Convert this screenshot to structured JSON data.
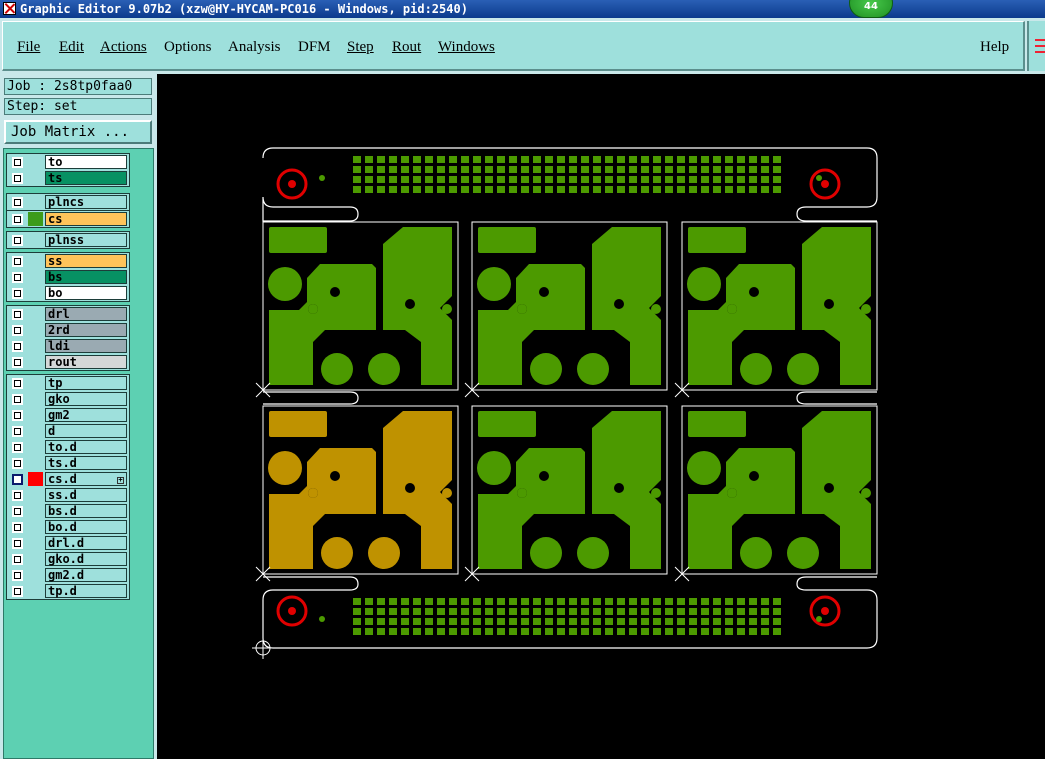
{
  "window": {
    "title": "Graphic Editor 9.07b2 (xzw@HY-HYCAM-PC016 - Windows, pid:2540)",
    "badge_count": "44"
  },
  "menubar": {
    "items": [
      {
        "label": "File",
        "underline": true
      },
      {
        "label": "Edit",
        "underline": true
      },
      {
        "label": "Actions",
        "underline": true
      },
      {
        "label": "Options",
        "underline": false
      },
      {
        "label": "Analysis",
        "underline": false
      },
      {
        "label": "DFM",
        "underline": false
      },
      {
        "label": "Step",
        "underline": true
      },
      {
        "label": "Rout",
        "underline": true
      },
      {
        "label": "Windows",
        "underline": true
      }
    ],
    "help_label": "Help"
  },
  "left_panel": {
    "job": "Job : 2s8tp0faa0",
    "step": "Step: set",
    "job_matrix_button": "Job Matrix ..."
  },
  "layers": [
    {
      "name": "to",
      "bg": "#ffffff",
      "color": "",
      "checked": false
    },
    {
      "name": "ts",
      "bg": "#079163",
      "color": "",
      "checked": false
    },
    {
      "name": "plncs",
      "bg": "#9ee0dc",
      "color": "",
      "checked": false
    },
    {
      "name": "cs",
      "bg": "#ffc45a",
      "color": "#3c9b1a",
      "checked": false
    },
    {
      "name": "plnss",
      "bg": "#9ee0dc",
      "color": "",
      "checked": false
    },
    {
      "name": "ss",
      "bg": "#ffc45a",
      "color": "",
      "checked": false
    },
    {
      "name": "bs",
      "bg": "#079163",
      "color": "",
      "checked": false
    },
    {
      "name": "bo",
      "bg": "#ffffff",
      "color": "",
      "checked": false
    },
    {
      "name": "drl",
      "bg": "#9aaab2",
      "color": "",
      "checked": false
    },
    {
      "name": "2rd",
      "bg": "#9aaab2",
      "color": "",
      "checked": false
    },
    {
      "name": "ldi",
      "bg": "#9aaab2",
      "color": "",
      "checked": false
    },
    {
      "name": "rout",
      "bg": "#d4d8d8",
      "color": "",
      "checked": false
    },
    {
      "name": "tp",
      "bg": "#9ee0dc",
      "color": "",
      "checked": false
    },
    {
      "name": "gko",
      "bg": "#9ee0dc",
      "color": "",
      "checked": false
    },
    {
      "name": "gm2",
      "bg": "#9ee0dc",
      "color": "",
      "checked": false
    },
    {
      "name": "d",
      "bg": "#9ee0dc",
      "color": "",
      "checked": false
    },
    {
      "name": "to.d",
      "bg": "#9ee0dc",
      "color": "",
      "checked": false
    },
    {
      "name": "ts.d",
      "bg": "#9ee0dc",
      "color": "",
      "checked": false
    },
    {
      "name": "cs.d",
      "bg": "#9ee0dc",
      "color": "#ff0000",
      "checked": true
    },
    {
      "name": "ss.d",
      "bg": "#9ee0dc",
      "color": "",
      "checked": false
    },
    {
      "name": "bs.d",
      "bg": "#9ee0dc",
      "color": "",
      "checked": false
    },
    {
      "name": "bo.d",
      "bg": "#9ee0dc",
      "color": "",
      "checked": false
    },
    {
      "name": "drl.d",
      "bg": "#9ee0dc",
      "color": "",
      "checked": false
    },
    {
      "name": "gko.d",
      "bg": "#9ee0dc",
      "color": "",
      "checked": false
    },
    {
      "name": "gm2.d",
      "bg": "#9ee0dc",
      "color": "",
      "checked": false
    },
    {
      "name": "tp.d",
      "bg": "#9ee0dc",
      "color": "",
      "checked": false
    }
  ],
  "colors": {
    "copper": "#4c9a00",
    "highlight": "#bf9200",
    "target_ring": "#e00000",
    "outline": "#ffffff",
    "canvas_bg": "#000000"
  }
}
